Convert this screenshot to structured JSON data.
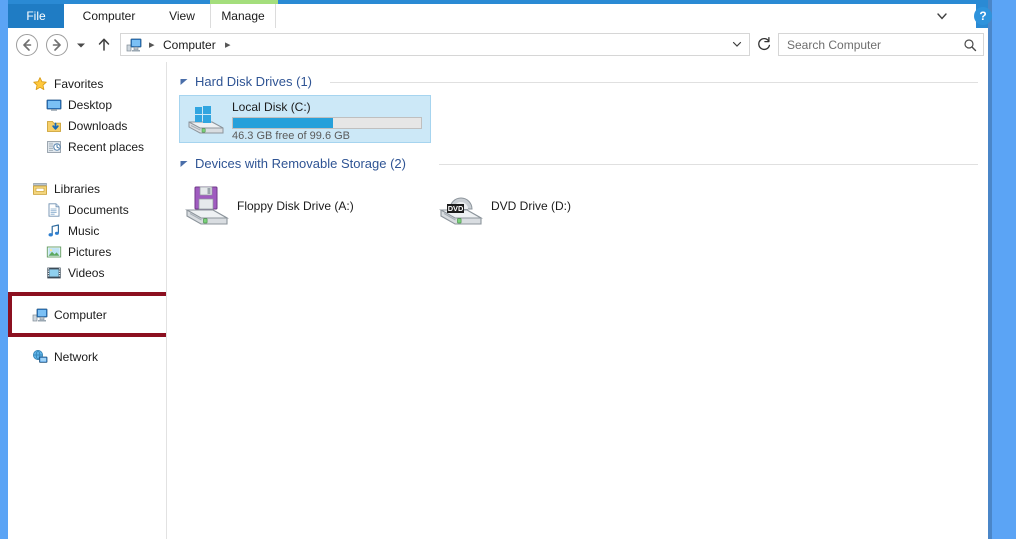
{
  "window": {
    "chrome_color": "#5ba4f5",
    "accent_color": "#2a8ad4"
  },
  "ribbon": {
    "tabs": [
      {
        "label": "File",
        "active": true,
        "icon": "file-tab"
      },
      {
        "label": "Computer",
        "active": false
      },
      {
        "label": "View",
        "active": false
      },
      {
        "label": "Manage",
        "active": false,
        "contextual_color": "#a4de7c"
      }
    ],
    "expand_icon": "chevron-down-icon",
    "help_label": "?",
    "help_icon": "help-icon"
  },
  "addressbar": {
    "back_icon": "back-arrow-icon",
    "back_glyph": "←",
    "forward_icon": "forward-arrow-icon",
    "forward_glyph": "→",
    "recent_glyph": "▼",
    "up_glyph": "↑",
    "breadcrumb_icon": "computer-icon",
    "breadcrumb": "Computer",
    "separator": "▸",
    "dropdown_glyph": "⌄",
    "refresh_glyph": "↻",
    "refresh_icon": "refresh-icon"
  },
  "search": {
    "placeholder": "Search Computer",
    "icon": "search-icon"
  },
  "sidebar": {
    "groups": [
      {
        "name": "Favorites",
        "icon": "star-icon",
        "items": [
          {
            "label": "Desktop",
            "icon": "desktop-icon"
          },
          {
            "label": "Downloads",
            "icon": "downloads-icon"
          },
          {
            "label": "Recent places",
            "icon": "recent-places-icon"
          }
        ]
      },
      {
        "name": "Libraries",
        "icon": "libraries-icon",
        "items": [
          {
            "label": "Documents",
            "icon": "documents-icon"
          },
          {
            "label": "Music",
            "icon": "music-icon"
          },
          {
            "label": "Pictures",
            "icon": "pictures-icon"
          },
          {
            "label": "Videos",
            "icon": "videos-icon"
          }
        ]
      },
      {
        "name": "Computer",
        "icon": "computer-icon",
        "selected": true,
        "annotated": true,
        "annotation_color": "#8c1020",
        "items": []
      },
      {
        "name": "Network",
        "icon": "network-icon",
        "items": []
      }
    ]
  },
  "content": {
    "sections": [
      {
        "title": "Hard Disk Drives (1)",
        "collapse_glyph": "◢",
        "drives": [
          {
            "name": "Local Disk (C:)",
            "icon": "hard-disk-icon",
            "free_text": "46.3 GB free of 99.6 GB",
            "free_gb": 46.3,
            "total_gb": 99.6,
            "used_percent": 53,
            "bar_color": "#26a0da",
            "selected": true
          }
        ]
      },
      {
        "title": "Devices with Removable Storage (2)",
        "collapse_glyph": "◢",
        "devices": [
          {
            "name": "Floppy Disk Drive (A:)",
            "icon": "floppy-disk-icon"
          },
          {
            "name": "DVD Drive (D:)",
            "icon": "dvd-drive-icon",
            "badge": "DVD"
          }
        ]
      }
    ]
  }
}
